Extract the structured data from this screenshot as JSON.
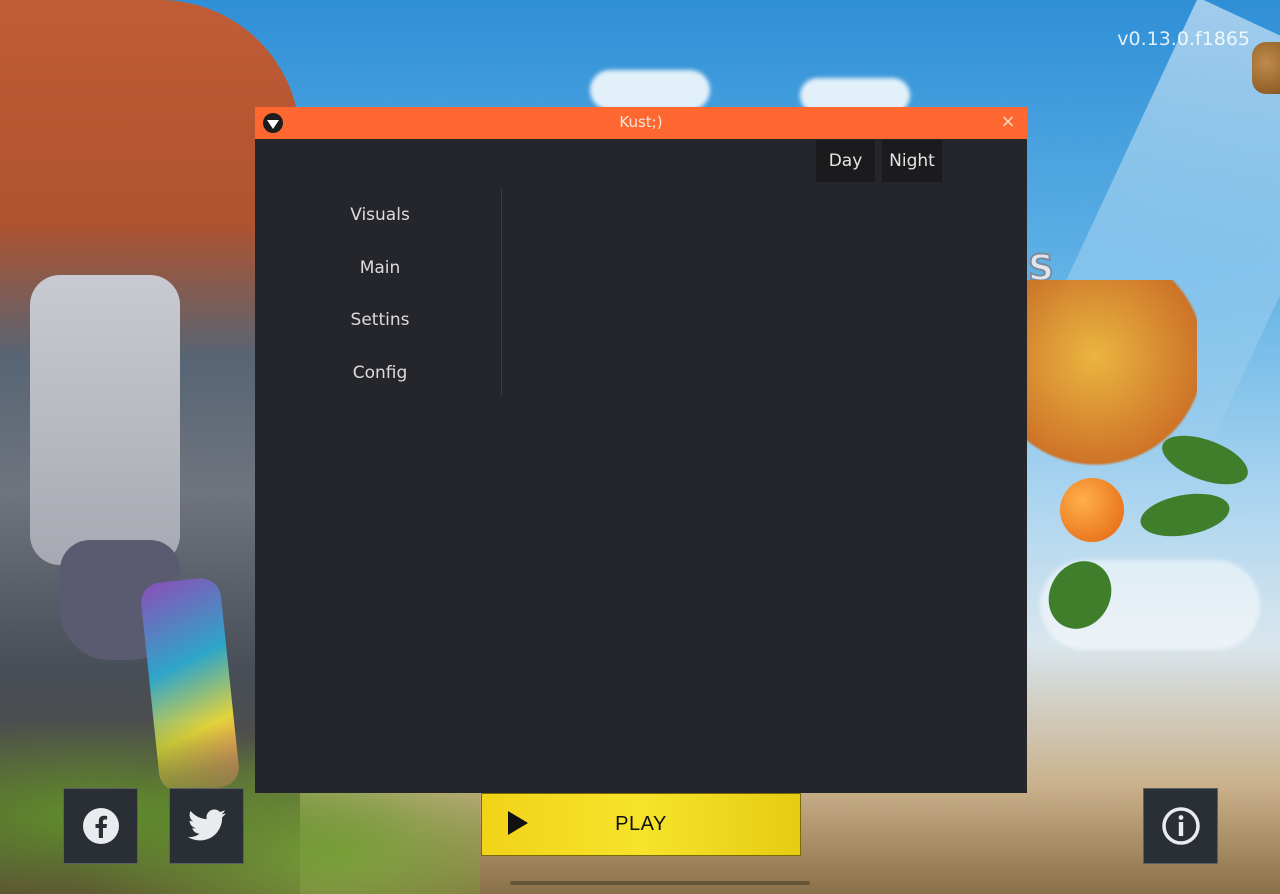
{
  "background": {
    "version_text": "v0.13.0.f1865"
  },
  "modal": {
    "title": "Kust;)",
    "close_glyph": "×",
    "theme_buttons": {
      "day": "Day",
      "night": "Night"
    },
    "menu": [
      {
        "label": "Visuals"
      },
      {
        "label": "Main"
      },
      {
        "label": "Settins"
      },
      {
        "label": "Config"
      }
    ],
    "colors": {
      "titlebar": "#ff6730",
      "body": "#25262b"
    }
  },
  "bottom": {
    "play_label": "PLAY",
    "icons": [
      "facebook-icon",
      "twitter-icon",
      "info-icon",
      "play-icon"
    ]
  }
}
